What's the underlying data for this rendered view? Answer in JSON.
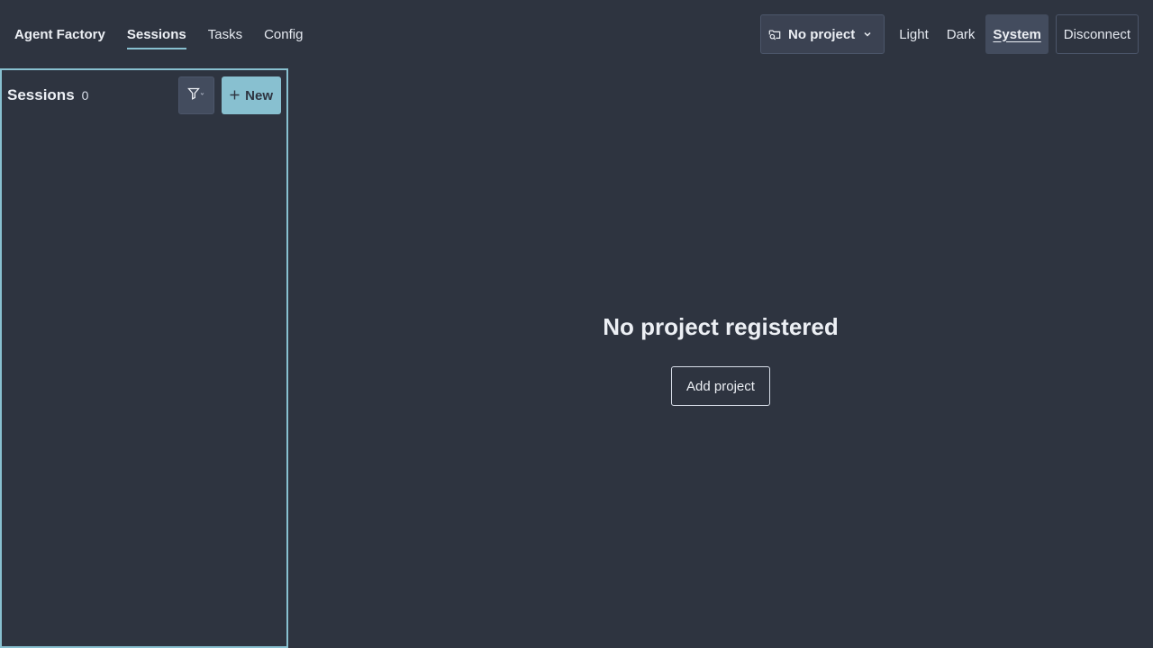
{
  "header": {
    "brand": "Agent Factory",
    "tabs": [
      {
        "label": "Sessions",
        "active": true
      },
      {
        "label": "Tasks",
        "active": false
      },
      {
        "label": "Config",
        "active": false
      }
    ],
    "project_select": {
      "label": "No project",
      "icon": "folder-search-icon"
    },
    "theme_options": [
      {
        "label": "Light",
        "active": false
      },
      {
        "label": "Dark",
        "active": false
      },
      {
        "label": "System",
        "active": true
      }
    ],
    "disconnect_label": "Disconnect"
  },
  "sidebar": {
    "title": "Sessions",
    "count": "0",
    "filter_icon": "filter-icon",
    "new_label": "New"
  },
  "main": {
    "empty_title": "No project registered",
    "add_project_label": "Add project"
  },
  "colors": {
    "background": "#2e3440",
    "accent": "#88c0d0",
    "border": "#4c566a",
    "text": "#eceff4"
  }
}
